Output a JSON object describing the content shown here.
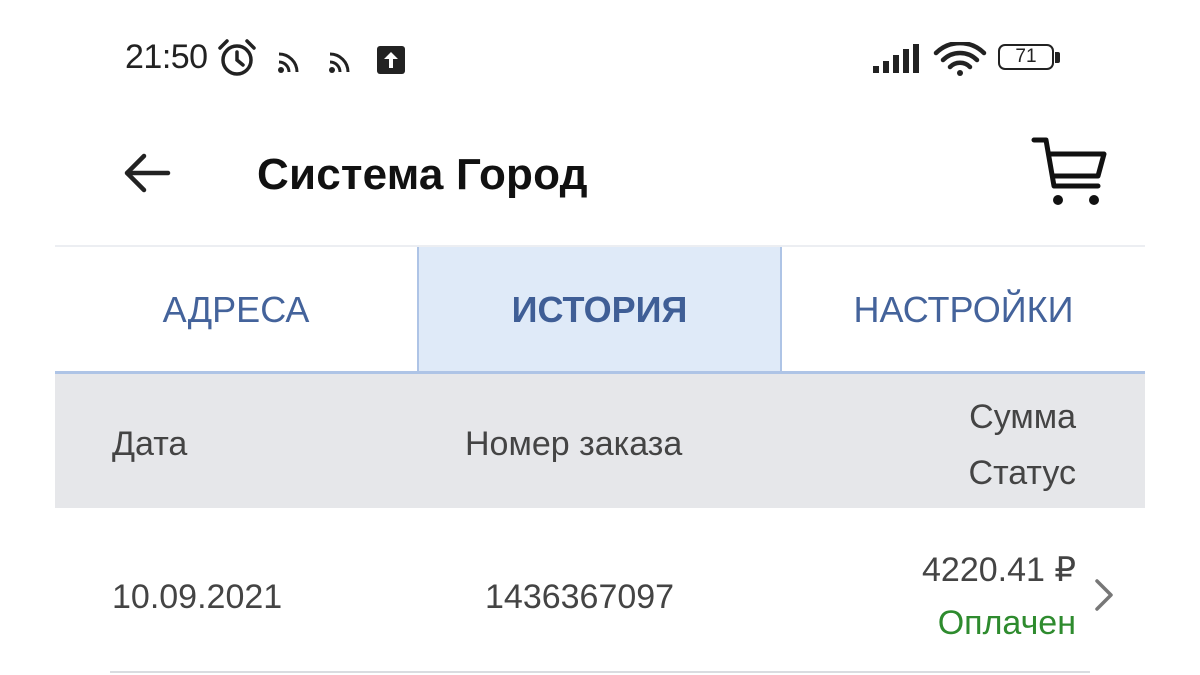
{
  "status_bar": {
    "time": "21:50",
    "battery_level": "71",
    "icons": [
      "alarm-icon",
      "cast-icon",
      "cast-icon",
      "upload-icon",
      "signal-icon",
      "wifi-icon",
      "battery-icon"
    ]
  },
  "app_bar": {
    "title": "Система Город",
    "back_icon": "arrow-left-icon",
    "cart_icon": "cart-icon"
  },
  "tabs": [
    {
      "label": "АДРЕСА",
      "selected": false
    },
    {
      "label": "ИСТОРИЯ",
      "selected": true
    },
    {
      "label": "НАСТРОЙКИ",
      "selected": false
    }
  ],
  "table": {
    "headers": {
      "date": "Дата",
      "order_number": "Номер заказа",
      "sum": "Сумма",
      "status": "Статус"
    },
    "rows": [
      {
        "date": "10.09.2021",
        "order_number": "1436367097",
        "sum": "4220.41 ₽",
        "status": "Оплачен"
      }
    ]
  },
  "colors": {
    "tab_text": "#44639b",
    "tab_selected_bg": "#dfeaf8",
    "tab_border": "#aec4e6",
    "header_bg": "#e6e7ea",
    "status_paid": "#2e8b2e"
  }
}
